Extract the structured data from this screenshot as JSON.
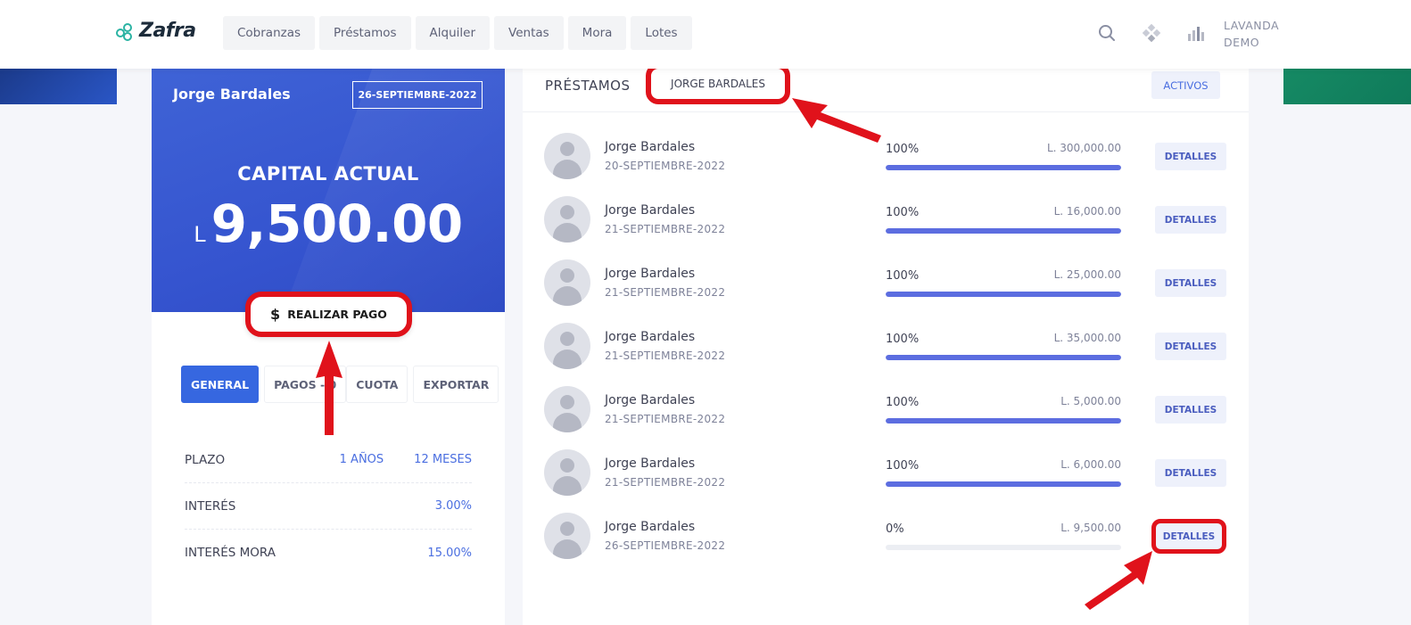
{
  "app": {
    "logo_text": "Zafra",
    "nav": [
      "Cobranzas",
      "Préstamos",
      "Alquiler",
      "Ventas",
      "Mora",
      "Lotes"
    ],
    "user": {
      "line1": "LAVANDA",
      "line2": "DEMO"
    }
  },
  "summary": {
    "name": "Jorge Bardales",
    "date": "26-SEPTIEMBRE-2022",
    "capital_label": "CAPITAL ACTUAL",
    "currency": "L",
    "amount": "9,500.00",
    "pay_button": "REALIZAR PAGO",
    "tabs": [
      "GENERAL",
      "PAGOS - 0",
      "CUOTA",
      "EXPORTAR"
    ],
    "info": [
      {
        "label": "PLAZO",
        "values": [
          "1 AÑOS",
          "12 MESES"
        ]
      },
      {
        "label": "INTERÉS",
        "values": [
          "3.00%"
        ]
      },
      {
        "label": "INTERÉS MORA",
        "values": [
          "15.00%"
        ]
      }
    ]
  },
  "loans": {
    "title": "PRÉSTAMOS",
    "filter": "JORGE BARDALES",
    "status": "ACTIVOS",
    "detail_label": "DETALLES",
    "rows": [
      {
        "name": "Jorge Bardales",
        "date": "20-SEPTIEMBRE-2022",
        "pct": "100%",
        "progress": 100,
        "amount": "L. 300,000.00"
      },
      {
        "name": "Jorge Bardales",
        "date": "21-SEPTIEMBRE-2022",
        "pct": "100%",
        "progress": 100,
        "amount": "L. 16,000.00"
      },
      {
        "name": "Jorge Bardales",
        "date": "21-SEPTIEMBRE-2022",
        "pct": "100%",
        "progress": 100,
        "amount": "L. 25,000.00"
      },
      {
        "name": "Jorge Bardales",
        "date": "21-SEPTIEMBRE-2022",
        "pct": "100%",
        "progress": 100,
        "amount": "L. 35,000.00"
      },
      {
        "name": "Jorge Bardales",
        "date": "21-SEPTIEMBRE-2022",
        "pct": "100%",
        "progress": 100,
        "amount": "L. 5,000.00"
      },
      {
        "name": "Jorge Bardales",
        "date": "21-SEPTIEMBRE-2022",
        "pct": "100%",
        "progress": 100,
        "amount": "L. 6,000.00"
      },
      {
        "name": "Jorge Bardales",
        "date": "26-SEPTIEMBRE-2022",
        "pct": "0%",
        "progress": 0,
        "amount": "L. 9,500.00"
      }
    ]
  },
  "colors": {
    "primary": "#3667e0",
    "hero": "#3554cf",
    "highlight": "#e0121b",
    "bar": "#5c6de0"
  }
}
